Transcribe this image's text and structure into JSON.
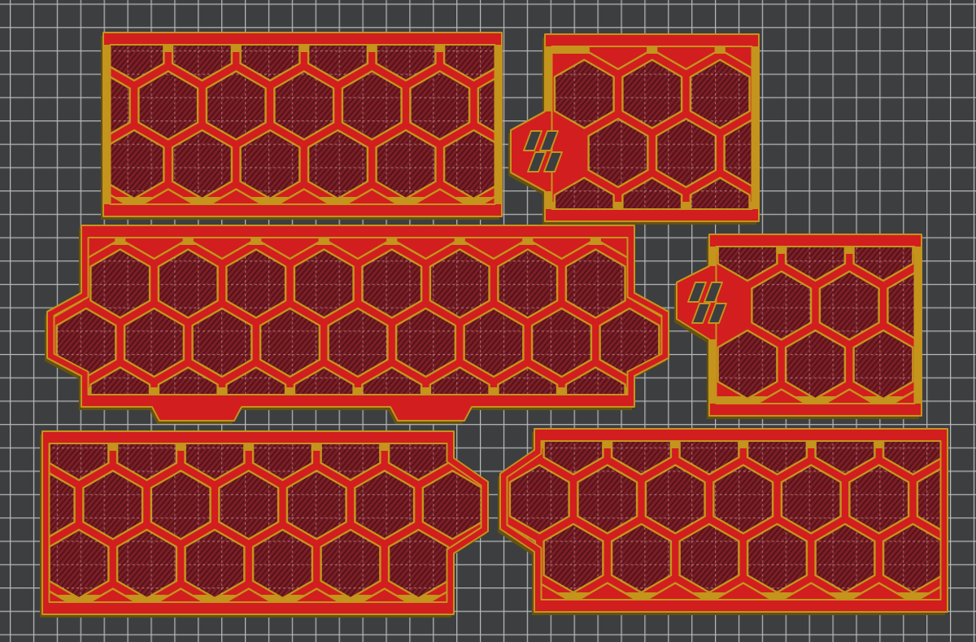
{
  "build_plate": {
    "parts": [
      {
        "kind": "rectangular"
      },
      {
        "kind": "logo-tab"
      },
      {
        "kind": "notched-both"
      },
      {
        "kind": "logo-tab"
      },
      {
        "kind": "notched-right"
      },
      {
        "kind": "notched-left"
      }
    ]
  }
}
